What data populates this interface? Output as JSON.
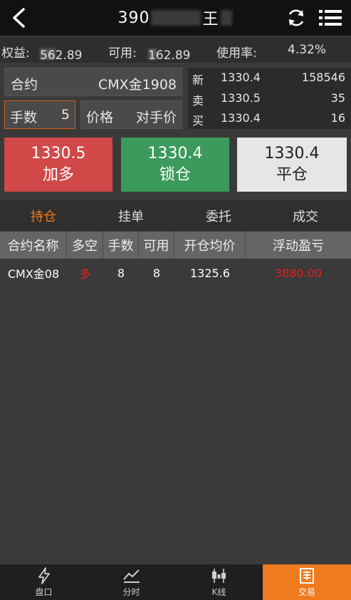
{
  "header": {
    "title_prefix": "390",
    "title_suffix": "王",
    "back_icon": "chevron-left-icon",
    "refresh_icon": "refresh-icon",
    "menu_icon": "list-menu-icon"
  },
  "account": {
    "equity_label": "权益:",
    "equity_value": "562.89",
    "available_label": "可用:",
    "available_value": "162.89",
    "usage_label": "使用率:",
    "usage_value": "4.32%"
  },
  "order": {
    "contract_label": "合约",
    "contract_value": "CMX金1908",
    "qty_label": "手数",
    "qty_value": "5",
    "price_label": "价格",
    "price_value": "对手价"
  },
  "quote": [
    {
      "label": "新",
      "price": "1330.4",
      "volume": "158546"
    },
    {
      "label": "卖",
      "price": "1330.5",
      "volume": "35"
    },
    {
      "label": "买",
      "price": "1330.4",
      "volume": "16"
    }
  ],
  "actions": {
    "add_price": "1330.5",
    "add_label": "加多",
    "lock_price": "1330.4",
    "lock_label": "锁仓",
    "close_price": "1330.4",
    "close_label": "平仓"
  },
  "tabs": [
    "持仓",
    "挂单",
    "委托",
    "成交"
  ],
  "active_tab": "持仓",
  "table": {
    "headers": [
      "合约名称",
      "多空",
      "手数",
      "可用",
      "开仓均价",
      "浮动盈亏"
    ],
    "rows": [
      {
        "contract": "CMX金08",
        "direction": "多",
        "qty": "8",
        "available": "8",
        "avg_price": "1325.6",
        "pnl": "3880.00"
      }
    ]
  },
  "nav": [
    {
      "label": "盘口",
      "icon": "lightning-icon"
    },
    {
      "label": "分时",
      "icon": "line-chart-icon"
    },
    {
      "label": "K线",
      "icon": "candlestick-icon"
    },
    {
      "label": "交易",
      "icon": "trade-document-icon"
    }
  ],
  "colors": {
    "accent": "#f07a1e",
    "buy_red": "#d04848",
    "green": "#3c9a5c",
    "pnl_red": "#e02020"
  }
}
